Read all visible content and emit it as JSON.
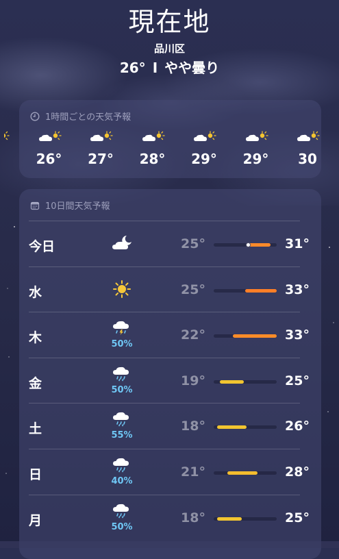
{
  "header": {
    "location": "現在地",
    "district": "品川区",
    "temperature": "26°",
    "separator": "I",
    "condition": "やや曇り"
  },
  "hourly": {
    "title": "1時間ごとの天気予報",
    "icon": "clock-icon",
    "items": [
      {
        "temp": "°",
        "icon": "cloud-sun-icon"
      },
      {
        "temp": "26°",
        "icon": "cloud-sun-icon"
      },
      {
        "temp": "27°",
        "icon": "cloud-sun-icon"
      },
      {
        "temp": "28°",
        "icon": "cloud-sun-icon"
      },
      {
        "temp": "29°",
        "icon": "cloud-sun-icon"
      },
      {
        "temp": "29°",
        "icon": "cloud-sun-icon"
      },
      {
        "temp": "30",
        "icon": "cloud-sun-icon"
      }
    ]
  },
  "ten_day": {
    "title": "10日間天気予報",
    "icon": "calendar-icon",
    "days": [
      {
        "day": "今日",
        "icon": "cloud-moon-icon",
        "precip": "",
        "low": "25°",
        "high": "31°",
        "bar_start": 0.55,
        "bar_end": 0.9,
        "bar_color": "#ff8a2a",
        "now_pos": 0.55
      },
      {
        "day": "水",
        "icon": "sun-icon",
        "precip": "",
        "low": "25°",
        "high": "33°",
        "bar_start": 0.5,
        "bar_end": 1.0,
        "bar_color": "#ff7f27",
        "now_pos": null
      },
      {
        "day": "木",
        "icon": "thunderstorm-icon",
        "precip": "50%",
        "low": "22°",
        "high": "33°",
        "bar_start": 0.3,
        "bar_end": 1.0,
        "bar_color": "#ff8c28",
        "now_pos": null
      },
      {
        "day": "金",
        "icon": "cloud-rain-icon",
        "precip": "50%",
        "low": "19°",
        "high": "25°",
        "bar_start": 0.1,
        "bar_end": 0.48,
        "bar_color": "#f2c530",
        "now_pos": null
      },
      {
        "day": "土",
        "icon": "cloud-rain-icon",
        "precip": "55%",
        "low": "18°",
        "high": "26°",
        "bar_start": 0.05,
        "bar_end": 0.52,
        "bar_color": "#f2c530",
        "now_pos": null
      },
      {
        "day": "日",
        "icon": "cloud-rain-icon",
        "precip": "40%",
        "low": "21°",
        "high": "28°",
        "bar_start": 0.22,
        "bar_end": 0.7,
        "bar_color": "#f4bd2e",
        "now_pos": null
      },
      {
        "day": "月",
        "icon": "cloud-rain-icon",
        "precip": "50%",
        "low": "18°",
        "high": "25°",
        "bar_start": 0.05,
        "bar_end": 0.45,
        "bar_color": "#f2c530",
        "now_pos": null
      }
    ]
  }
}
